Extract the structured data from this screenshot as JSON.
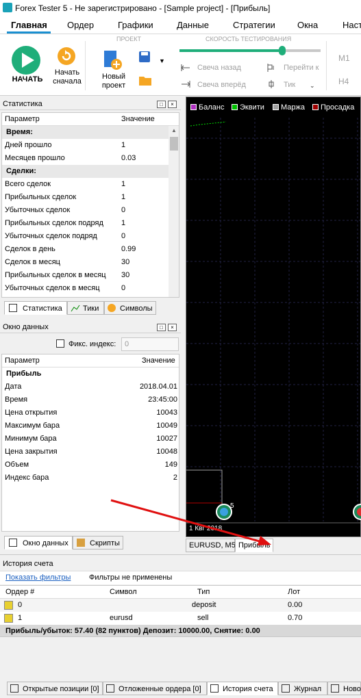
{
  "window": {
    "title": "Forex Tester 5 - Не зарегистрировано - [Sample project] - [Прибыль]"
  },
  "menu": [
    "Главная",
    "Ордер",
    "Графики",
    "Данные",
    "Стратегии",
    "Окна",
    "Наст"
  ],
  "ribbon": {
    "start_label": "НАЧАТЬ",
    "restart_label": "Начать сначала",
    "new_project_label": "Новый проект",
    "project_group": "ПРОЕКТ",
    "speed_group": "СКОРОСТЬ ТЕСТИРОВАНИЯ",
    "speed_value": 0.73,
    "candle_back": "Свеча назад",
    "candle_forward": "Свеча вперёд",
    "goto": "Перейти к",
    "tick": "Тик",
    "tf1": "M1",
    "tf2": "H4"
  },
  "stats": {
    "title": "Статистика",
    "col_param": "Параметр",
    "col_value": "Значение",
    "rows": [
      {
        "p": "Время:",
        "v": "",
        "group": true
      },
      {
        "p": "Дней прошло",
        "v": "1"
      },
      {
        "p": "Месяцев прошло",
        "v": "0.03"
      },
      {
        "p": "Сделки:",
        "v": "",
        "group": true
      },
      {
        "p": "Всего сделок",
        "v": "1"
      },
      {
        "p": "Прибыльных сделок",
        "v": "1"
      },
      {
        "p": "Убыточных сделок",
        "v": "0"
      },
      {
        "p": "Прибыльных сделок подряд",
        "v": "1"
      },
      {
        "p": "Убыточных сделок подряд",
        "v": "0"
      },
      {
        "p": "Сделок в день",
        "v": "0.99"
      },
      {
        "p": "Сделок в месяц",
        "v": "30"
      },
      {
        "p": "Прибыльных сделок в месяц",
        "v": "30"
      },
      {
        "p": "Убыточных сделок в месяц",
        "v": "0"
      }
    ],
    "tabs": [
      "Статистика",
      "Тики",
      "Символы"
    ]
  },
  "data_window": {
    "title": "Окно данных",
    "fix_index_label": "Фикс. индекс:",
    "fix_index_value": "0",
    "col_param": "Параметр",
    "col_value": "Значение",
    "group": "Прибыль",
    "rows": [
      {
        "p": "Дата",
        "v": "2018.04.01"
      },
      {
        "p": "Время",
        "v": "23:45:00"
      },
      {
        "p": "Цена открытия",
        "v": "10043"
      },
      {
        "p": "Максимум бара",
        "v": "10049"
      },
      {
        "p": "Минимум бара",
        "v": "10027"
      },
      {
        "p": "Цена закрытия",
        "v": "10048"
      },
      {
        "p": "Объем",
        "v": "149"
      },
      {
        "p": "Индекс бара",
        "v": "2"
      }
    ],
    "tabs": [
      "Окно данных",
      "Скрипты"
    ]
  },
  "chart": {
    "legend": [
      {
        "name": "Баланс",
        "color": "#b030c0"
      },
      {
        "name": "Эквити",
        "color": "#00c000"
      },
      {
        "name": "Маржа",
        "color": "#a0a0a0"
      },
      {
        "name": "Просадка",
        "color": "#a00000"
      }
    ],
    "date_label": "1 Квг 2018",
    "marker_label": "5",
    "tabs": [
      "EURUSD, M5",
      "Прибыль"
    ]
  },
  "history": {
    "title": "История счета",
    "show_filters": "Показать фильтры",
    "filters_state": "Фильтры не применены",
    "cols": [
      "Ордер #",
      "Символ",
      "Тип",
      "Лот"
    ],
    "rows": [
      {
        "order": "0",
        "symbol": "",
        "type": "deposit",
        "lot": "0.00"
      },
      {
        "order": "1",
        "symbol": "eurusd",
        "type": "sell",
        "lot": "0.70"
      }
    ],
    "summary": "Прибыль/убыток: 57.40 (82 пунктов) Депозит: 10000.00, Снятие: 0.00"
  },
  "bottom_tabs": [
    "Открытые позиции [0]",
    "Отложенные ордера [0]",
    "История счета",
    "Журнал",
    "Ново"
  ]
}
